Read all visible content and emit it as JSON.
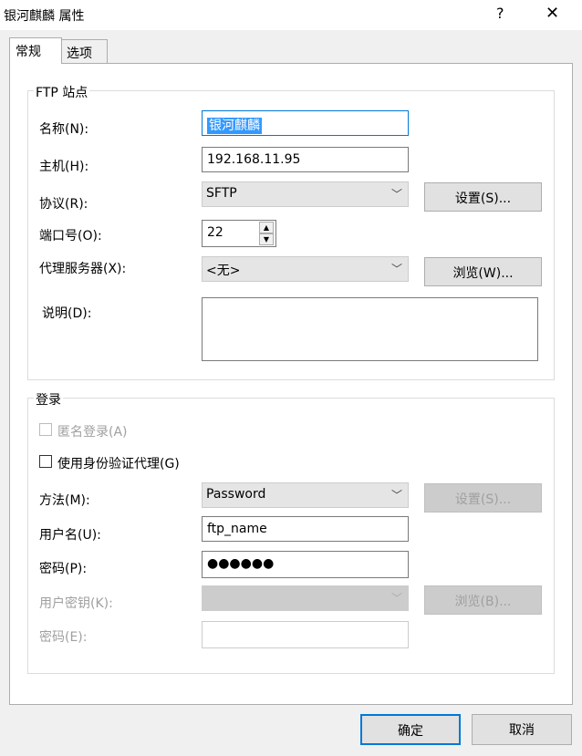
{
  "window": {
    "title": "银河麒麟 属性",
    "help_label": "?",
    "close_label": "✕"
  },
  "tabs": [
    {
      "label": "常规"
    },
    {
      "label": "选项"
    }
  ],
  "ftp_site": {
    "group_label": "FTP 站点",
    "name_label": "名称(N):",
    "name_value": "银河麒麟",
    "host_label": "主机(H):",
    "host_value": "192.168.11.95",
    "protocol_label": "协议(R):",
    "protocol_value": "SFTP",
    "protocol_settings_button": "设置(S)...",
    "port_label": "端口号(O):",
    "port_value": "22",
    "proxy_label": "代理服务器(X):",
    "proxy_value": "<无>",
    "proxy_browse_button": "浏览(W)...",
    "description_label": "说明(D):",
    "description_value": ""
  },
  "login": {
    "group_label": "登录",
    "anonymous_label": "匿名登录(A)",
    "auth_agent_label": "使用身份验证代理(G)",
    "method_label": "方法(M):",
    "method_value": "Password",
    "method_settings_button": "设置(S)...",
    "username_label": "用户名(U):",
    "username_value": "ftp_name",
    "password_label": "密码(P):",
    "password_value": "●●●●●●",
    "user_key_label": "用户密钥(K):",
    "user_key_value": "",
    "key_browse_button": "浏览(B)...",
    "passphrase_label": "密码(E):",
    "passphrase_value": ""
  },
  "footer": {
    "ok_button": "确定",
    "cancel_button": "取消"
  }
}
